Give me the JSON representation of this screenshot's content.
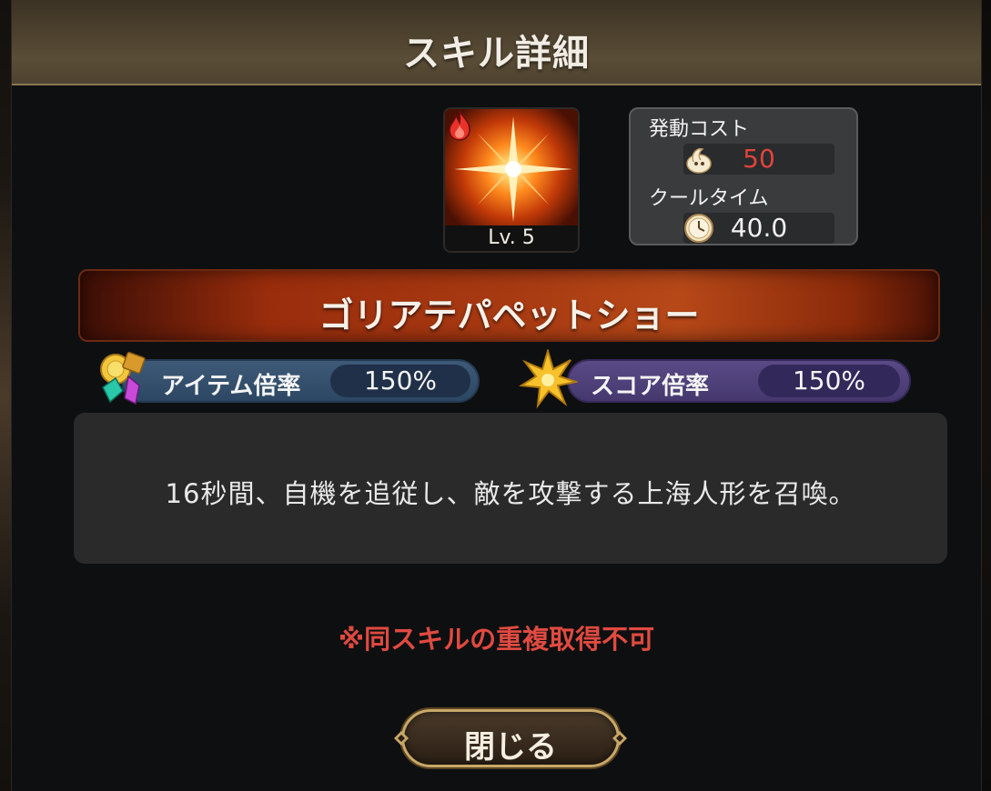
{
  "dialog": {
    "title": "スキル詳細"
  },
  "skill": {
    "level": "Lv. 5",
    "element_icon": "fire-icon",
    "name": "ゴリアテパペットショー"
  },
  "cost": {
    "activation_label": "発動コスト",
    "activation_value": "50",
    "activation_color": "#e0443c",
    "cooldown_label": "クールタイム",
    "cooldown_value": "40.0"
  },
  "rates": {
    "item_label": "アイテム倍率",
    "item_value": "150%",
    "score_label": "スコア倍率",
    "score_value": "150%"
  },
  "description": "16秒間、自機を追従し、敵を攻撃する上海人形を召喚。",
  "notice": "※同スキルの重複取得不可",
  "close_button": "閉じる"
}
